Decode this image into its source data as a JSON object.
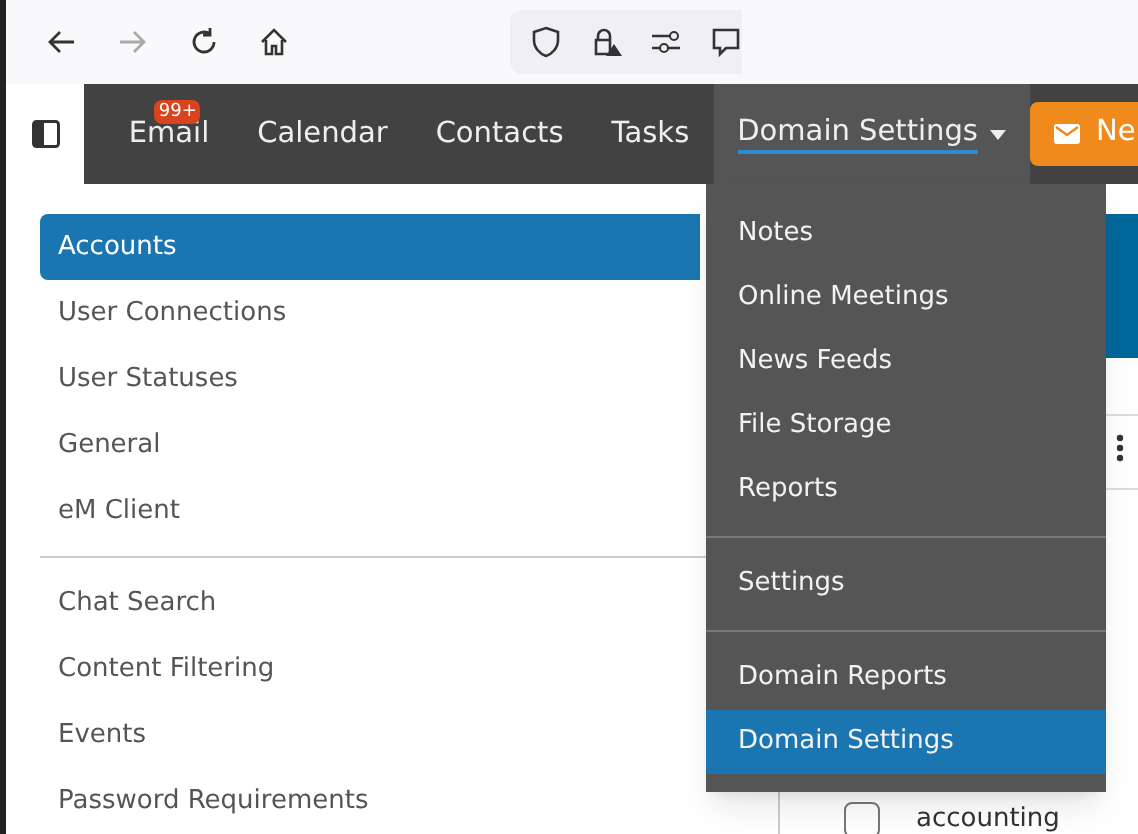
{
  "nav": {
    "tabs": [
      {
        "label": "Email",
        "badge": "99+",
        "selected": false
      },
      {
        "label": "Calendar",
        "selected": false
      },
      {
        "label": "Contacts",
        "selected": false
      },
      {
        "label": "Tasks",
        "selected": false
      },
      {
        "label": "Domain Settings",
        "selected": true,
        "expanded": true
      }
    ],
    "new_button": "Ne"
  },
  "sidebar": {
    "groups": [
      [
        {
          "label": "Accounts",
          "selected": true
        },
        {
          "label": "User Connections",
          "selected": false
        },
        {
          "label": "User Statuses",
          "selected": false
        },
        {
          "label": "General",
          "selected": false
        },
        {
          "label": "eM Client",
          "selected": false
        }
      ],
      [
        {
          "label": "Chat Search",
          "selected": false
        },
        {
          "label": "Content Filtering",
          "selected": false
        },
        {
          "label": "Events",
          "selected": false
        },
        {
          "label": "Password Requirements",
          "selected": false
        }
      ]
    ]
  },
  "main": {
    "row": {
      "label": "accounting",
      "checked": false
    }
  },
  "menu": {
    "groups": [
      [
        {
          "label": "Notes",
          "selected": false
        },
        {
          "label": "Online Meetings",
          "selected": false
        },
        {
          "label": "News Feeds",
          "selected": false
        },
        {
          "label": "File Storage",
          "selected": false
        },
        {
          "label": "Reports",
          "selected": false
        }
      ],
      [
        {
          "label": "Settings",
          "selected": false
        }
      ],
      [
        {
          "label": "Domain Reports",
          "selected": false
        },
        {
          "label": "Domain Settings",
          "selected": true
        }
      ]
    ]
  }
}
